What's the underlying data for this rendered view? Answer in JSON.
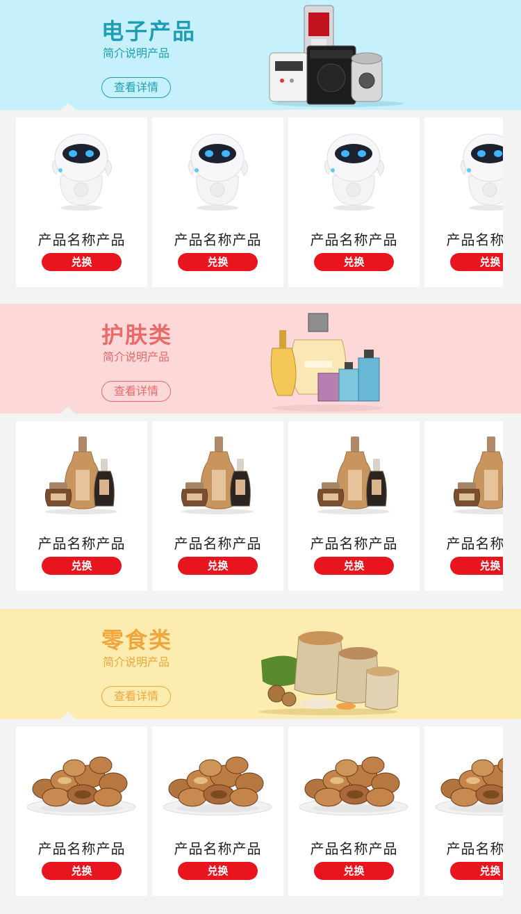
{
  "colors": {
    "page_bg": "#f3f3f3",
    "redeem_bg": "#e8141e",
    "electronics": {
      "bg": "#c6f0fb",
      "accent": "#1f9db5"
    },
    "skincare": {
      "bg": "#fcd8d8",
      "accent": "#e86a6a"
    },
    "snacks": {
      "bg": "#fcecb0",
      "accent": "#f0a63b"
    }
  },
  "sections": [
    {
      "key": "electronics",
      "title": "电子产品",
      "subtitle": "简介说明产品",
      "detail_label": "查看详情",
      "illustration": "home-appliances-icon",
      "product_icon": "robot-speaker-icon",
      "products": [
        {
          "name": "产品名称产品",
          "action": "兑换"
        },
        {
          "name": "产品名称产品",
          "action": "兑换"
        },
        {
          "name": "产品名称产品",
          "action": "兑换"
        },
        {
          "name": "产品名称产品",
          "action": "兑换"
        }
      ]
    },
    {
      "key": "skincare",
      "title": "护肤类",
      "subtitle": "简介说明产品",
      "detail_label": "查看详情",
      "illustration": "perfume-bottles-icon",
      "product_icon": "serum-bottles-icon",
      "products": [
        {
          "name": "产品名称产品",
          "action": "兑换"
        },
        {
          "name": "产品名称产品",
          "action": "兑换"
        },
        {
          "name": "产品名称产品",
          "action": "兑换"
        },
        {
          "name": "产品名称产品",
          "action": "兑换"
        }
      ]
    },
    {
      "key": "snacks",
      "title": "零食类",
      "subtitle": "简介说明产品",
      "detail_label": "查看详情",
      "illustration": "nut-sacks-icon",
      "product_icon": "pecan-plate-icon",
      "products": [
        {
          "name": "产品名称产品",
          "action": "兑换"
        },
        {
          "name": "产品名称产品",
          "action": "兑换"
        },
        {
          "name": "产品名称产品",
          "action": "兑换"
        },
        {
          "name": "产品名称产品",
          "action": "兑换"
        }
      ]
    }
  ]
}
